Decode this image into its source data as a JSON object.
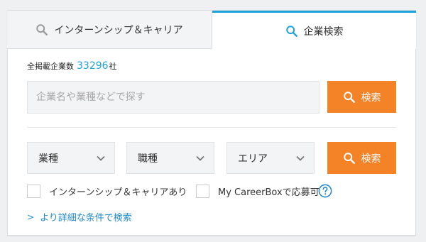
{
  "tabs": [
    {
      "label": "インターンシップ＆キャリア",
      "icon": "search-icon",
      "active": false
    },
    {
      "label": "企業検索",
      "icon": "search-icon",
      "active": true
    }
  ],
  "summary": {
    "prefix": "全掲載企業数",
    "count": "33296",
    "suffix": "社"
  },
  "search": {
    "placeholder": "企業名や業種などで探す",
    "value": "",
    "button_label": "検索"
  },
  "filters": {
    "selects": [
      {
        "label": "業種",
        "icon": "chevron-down-icon"
      },
      {
        "label": "職種",
        "icon": "chevron-down-icon"
      },
      {
        "label": "エリア",
        "icon": "chevron-down-icon"
      }
    ],
    "button_label": "検索"
  },
  "checkboxes": [
    {
      "label": "インターンシップ＆キャリアあり",
      "checked": false
    },
    {
      "label": "My CareerBoxで応募可",
      "checked": false
    }
  ],
  "help_icon": "question-circle-icon",
  "detail_link": {
    "label": "より詳細な条件で検索",
    "icon": "chevron-right-icon"
  },
  "colors": {
    "accent": "#1ea3dd",
    "button": "#f48226",
    "link": "#1e88c8"
  }
}
